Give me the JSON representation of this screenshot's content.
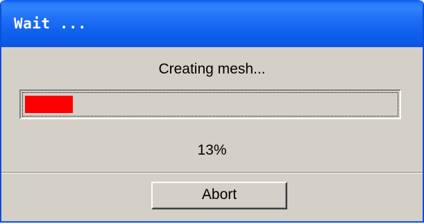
{
  "window": {
    "title": "Wait ..."
  },
  "dialog": {
    "status_text": "Creating mesh...",
    "progress_percent": 13,
    "progress_label": "13%",
    "abort_label": "Abort"
  },
  "colors": {
    "progress_fill": "#ff0000",
    "titlebar": "#0b55e0",
    "background": "#d4d0c8"
  }
}
